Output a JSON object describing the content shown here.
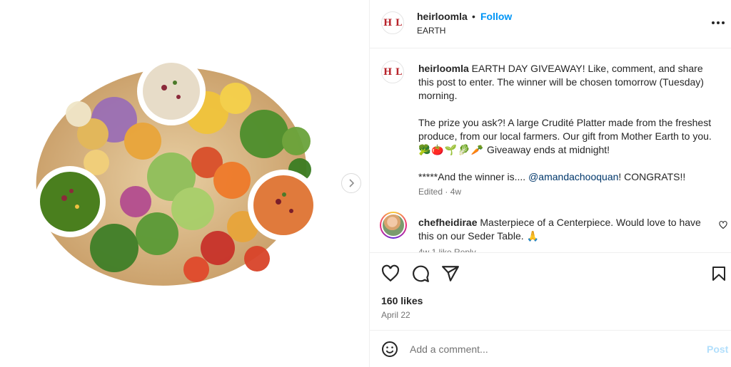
{
  "post": {
    "username": "heirloomla",
    "brand_avatar_text": "H L",
    "separator": "•",
    "follow_label": "Follow",
    "location": "EARTH",
    "more_icon": "more-horizontal-icon"
  },
  "caption": {
    "username": "heirloomla",
    "paragraph1": " EARTH DAY GIVEAWAY! Like, comment, and share this post to enter. The winner will be chosen tomorrow (Tuesday) morning.",
    "paragraph2": "The prize you ask?! A large Crudité Platter made from the freshest produce, from our local farmers. Our gift from Mother Earth to you. ",
    "emojis": "🥦🍅🌱🥬🥕",
    "paragraph2_end": " Giveaway ends at midnight!",
    "paragraph3_start": "*****And the winner is.... ",
    "mention": "@amandachooquan",
    "paragraph3_end": "! CONGRATS!!",
    "meta": "Edited · 4w"
  },
  "comment": {
    "username": "chefheidirae",
    "text": " Masterpiece of a Centerpiece. Would love to have this on our Seder Table. ",
    "emoji": "🙏",
    "meta": "4w   1 like   Reply"
  },
  "actions": {
    "like_icon": "heart-icon",
    "comment_icon": "comment-icon",
    "share_icon": "send-icon",
    "save_icon": "bookmark-icon"
  },
  "likes": "160 likes",
  "date": "April 22",
  "add_comment": {
    "placeholder": "Add a comment...",
    "post_label": "Post"
  },
  "colors": {
    "accent_blue": "#0095f6",
    "brand_red": "#b8252c",
    "post_disabled": "#b2dffc",
    "secondary_text": "#737373"
  }
}
